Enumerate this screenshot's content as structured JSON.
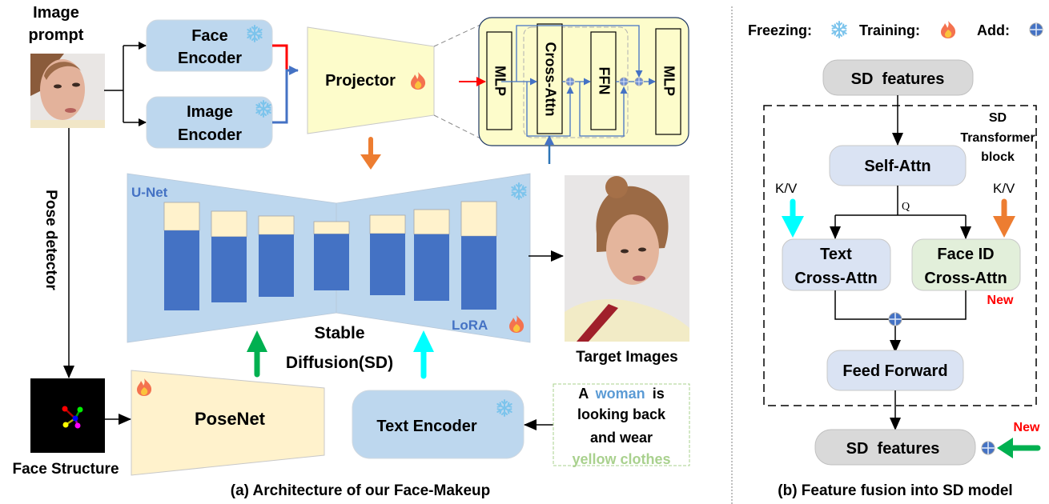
{
  "legend": {
    "freezing_label": "Freezing:",
    "training_label": "Training:",
    "add_label": "Add:",
    "freezing_icon": "snowflake-icon",
    "training_icon": "fire-icon",
    "add_icon": "add-circle-icon"
  },
  "part_a": {
    "image_prompt_line1": "Image",
    "image_prompt_line2": "prompt",
    "face_encoder_line1": "Face",
    "face_encoder_line2": "Encoder",
    "image_encoder_line1": "Image",
    "image_encoder_line2": "Encoder",
    "projector": "Projector",
    "projector_detail": {
      "mlp_in": "MLP",
      "cross_attn": "Cross-Attn",
      "ffn": "FFN",
      "mlp_out": "MLP"
    },
    "unet_label": "U-Net",
    "lora_label": "LoRA",
    "stable_line1": "Stable",
    "stable_line2": "Diffusion(SD)",
    "target_images": "Target Images",
    "pose_detector": "Pose detector",
    "face_structure": "Face Structure",
    "posenet": "PoseNet",
    "text_encoder": "Text Encoder",
    "prompt_text": {
      "w1": "A",
      "w2": "woman",
      "w3": "is",
      "line2": "looking back",
      "line3": "and wear",
      "line4": "yellow clothes"
    },
    "caption": "(a) Architecture of our Face-Makeup"
  },
  "part_b": {
    "sd_features_top": "SD  features",
    "block_label_1": "SD",
    "block_label_2": "Transformer",
    "block_label_3": "block",
    "self_attn": "Self-Attn",
    "kv_left": "K/V",
    "kv_right": "K/V",
    "q_label": "Q",
    "text_cross_1": "Text",
    "text_cross_2": "Cross-Attn",
    "face_cross_1": "Face ID",
    "face_cross_2": "Cross-Attn",
    "new_label_1": "New",
    "feed_forward": "Feed Forward",
    "sd_features_bottom": "SD  features",
    "new_label_2": "New",
    "caption": "(b) Feature fusion into SD model"
  },
  "colors": {
    "encoder_fill": "#bdd7ee",
    "projector_fill": "#fdfccb",
    "unet_fill": "#bdd7ee",
    "unet_block_dark": "#4472c4",
    "unet_block_light": "#fff2cc",
    "posenet_fill": "#fff2cc",
    "red_arrow": "#ff0000",
    "blue_arrow": "#4472c4",
    "orange_arrow": "#ed7d31",
    "green_arrow": "#00b050",
    "cyan_arrow": "#00ffff",
    "woman_word": "#5b9bd5",
    "yellow_clothes_word": "#a9d18e",
    "new_red": "#ff0000",
    "sd_features_fill": "#d9d9d9",
    "attn_fill": "#dae3f3",
    "face_attn_fill": "#e2efda"
  },
  "unet_blocks": [
    {
      "light": 0.26,
      "dark": 0.74
    },
    {
      "light": 0.28,
      "dark": 0.72
    },
    {
      "light": 0.23,
      "dark": 0.77
    },
    {
      "light": 0.18,
      "dark": 0.82
    },
    {
      "light": 0.23,
      "dark": 0.77
    },
    {
      "light": 0.27,
      "dark": 0.73
    },
    {
      "light": 0.32,
      "dark": 0.68
    }
  ]
}
